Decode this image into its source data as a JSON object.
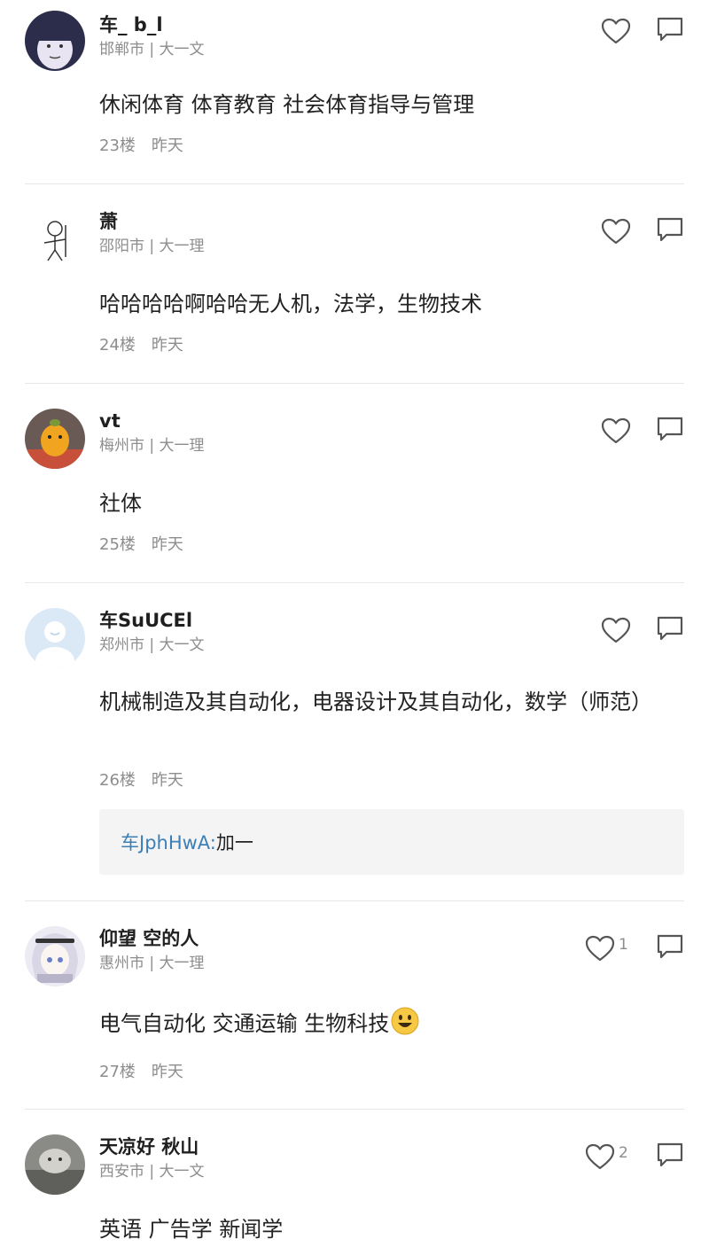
{
  "colors": {
    "link_blue": "#3c7fb6",
    "meta_gray": "#8d8d8d",
    "divider": "#e8e8e8",
    "subreply_bg": "#f4f4f4"
  },
  "comments": [
    {
      "username": "车_ b_l",
      "location": "邯郸市 | 大一文",
      "text": "休闲体育 体育教育 社会体育指导与管理",
      "floor": "23楼",
      "time": "昨天",
      "like_count": "",
      "avatar": "cartoon-face-avatar"
    },
    {
      "username": "萧",
      "location": "邵阳市 | 大一理",
      "text": "哈哈哈哈啊哈哈无人机，法学，生物技术",
      "floor": "24楼",
      "time": "昨天",
      "like_count": "",
      "avatar": "stick-figure-avatar"
    },
    {
      "username": "vt",
      "location": "梅州市 | 大一理",
      "text": "社体",
      "floor": "25楼",
      "time": "昨天",
      "like_count": "",
      "avatar": "orange-toy-avatar"
    },
    {
      "username": "车SuUCEl",
      "location": "郑州市 | 大一文",
      "text": "机械制造及其自动化，电器设计及其自动化，数学（师范）",
      "floor": "26楼",
      "time": "昨天",
      "like_count": "",
      "avatar": "default-avatar",
      "subreply": {
        "user": "车JphHwA:",
        "text": " 加一"
      }
    },
    {
      "username": "仰望 空的人",
      "location": "惠州市 | 大一理",
      "text": "电气自动化 交通运输 生物科技",
      "floor": "27楼",
      "time": "昨天",
      "like_count": "1",
      "avatar": "anime-girl-avatar",
      "emoji": "smile-emoji"
    },
    {
      "username": "天凉好 秋山",
      "location": "西安市 | 大一文",
      "text": "英语 广告学 新闻学",
      "floor": "",
      "time": "",
      "like_count": "2",
      "avatar": "photo-avatar"
    }
  ]
}
